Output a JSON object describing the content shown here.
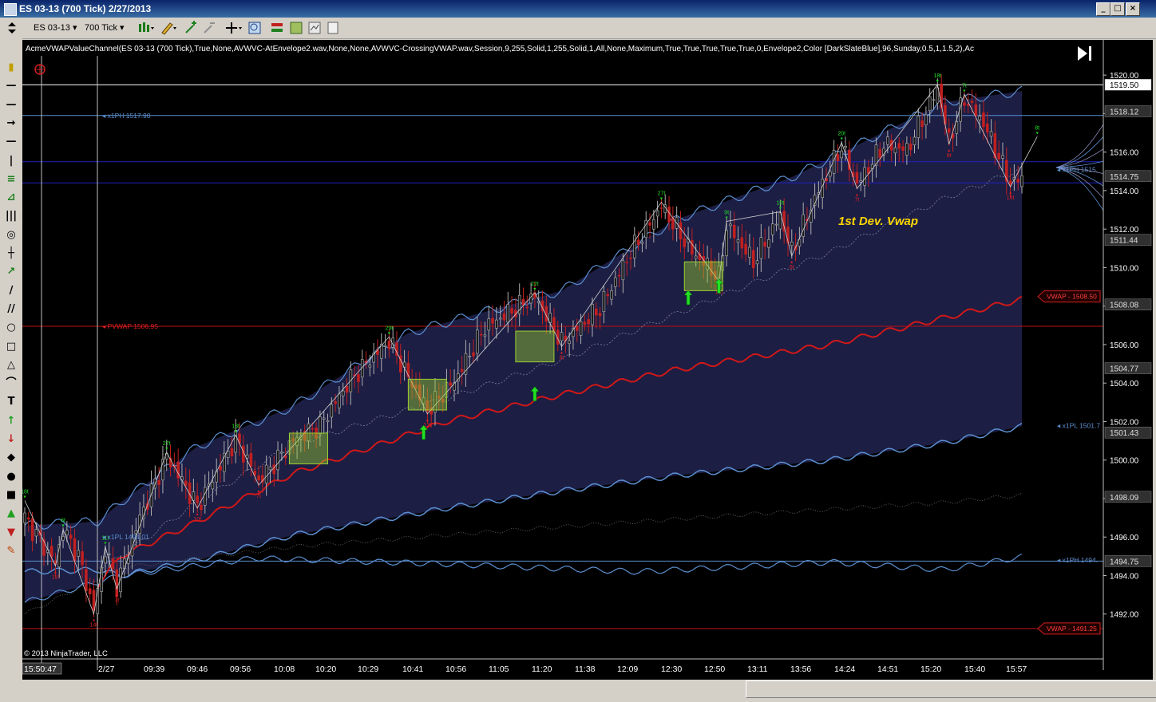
{
  "window": {
    "title": "ES 03-13 (700 Tick)  2/27/2013",
    "min_label": "_",
    "max_label": "□",
    "close_label": "×"
  },
  "toolbar": {
    "instrument": "ES 03-13",
    "interval": "700 Tick"
  },
  "lefttools": {
    "items": [
      "▮",
      "—",
      "—",
      "→",
      "—",
      "|",
      "≡",
      "⊿",
      "|||",
      "◎",
      "┼",
      "↗",
      "/",
      "//",
      "○",
      "□",
      "△",
      "⌒",
      "T",
      "↑",
      "↓",
      "◆",
      "●",
      "■",
      "▲",
      "▼",
      "✎"
    ]
  },
  "chart": {
    "indicator_label": "AcmeVWAPValueChannel(ES 03-13 (700 Tick),True,None,AVWVC-AtEnvelope2.wav,None,None,AVWVC-CrossingVWAP.wav,Session,9,255,Solid,1,255,Solid,1,All,None,Maximum,True,True,True,True,True,0,Envelope2,Color [DarkSlateBlue],96,Sunday,0.5,1,1.5,2),Ac",
    "annotation": "1st Dev. Vwap",
    "copyright": "© 2013 NinjaTrader, LLC",
    "colors": {
      "background": "#000000",
      "channel_fill": "#1e2048",
      "vwap": "#d01818",
      "band": "#5b8fd0",
      "inner_band": "#8080a0",
      "up_bar": "#b0b0b0",
      "down_bar": "#c02020",
      "swing_up": "#20e020",
      "swing_down": "#e02020",
      "annotation": "#ffd700",
      "box": "#9acd32",
      "arrow": "#22e022"
    }
  },
  "chart_data": {
    "type": "candlestick",
    "ylim": [
      1490,
      1521
    ],
    "y_ticks": [
      1492,
      1494,
      1496,
      1498,
      1500,
      1502,
      1504,
      1506,
      1508,
      1510,
      1512,
      1514,
      1516,
      1518,
      1520
    ],
    "y_tick_labels": [
      "1492.00",
      "1494.00",
      "1496.00",
      "1498.00",
      "1500.00",
      "1502.00",
      "1504.00",
      "1506.00",
      "1508.00",
      "1510.00",
      "1512.00",
      "1514.00",
      "1516.00",
      "1518.00",
      "1520.00"
    ],
    "x_tick_labels": [
      "15:50:47",
      "2/27",
      "09:39",
      "09:46",
      "09:56",
      "10:08",
      "10:20",
      "10:29",
      "10:41",
      "10:56",
      "11:05",
      "11:20",
      "11:38",
      "12:09",
      "12:30",
      "12:50",
      "13:11",
      "13:56",
      "14:24",
      "14:51",
      "15:20",
      "15:40",
      "15:57"
    ],
    "price_markers": [
      {
        "label": "1519.50",
        "value": 1519.5,
        "style": "white"
      },
      {
        "label": "1518.12",
        "value": 1518.12,
        "style": "gray"
      },
      {
        "label": "1514.75",
        "value": 1514.75,
        "style": "gray"
      },
      {
        "label": "1511.44",
        "value": 1511.44,
        "style": "gray"
      },
      {
        "label": "1508.08",
        "value": 1508.08,
        "style": "gray"
      },
      {
        "label": "1504.77",
        "value": 1504.77,
        "style": "gray"
      },
      {
        "label": "1501.43",
        "value": 1501.43,
        "style": "gray"
      },
      {
        "label": "1498.09",
        "value": 1498.09,
        "style": "gray"
      },
      {
        "label": "1494.75",
        "value": 1494.75,
        "style": "gray"
      }
    ],
    "level_labels": [
      {
        "label": "x1PH 1517.90",
        "value": 1517.9
      },
      {
        "label": "PVWAP 1506.95",
        "value": 1506.95
      },
      {
        "label": "x1PL 1494.01",
        "value": 1496.0
      },
      {
        "label": "x1PH 1515.",
        "value": 1515.1
      },
      {
        "label": "x1PL 1501.7",
        "value": 1501.8
      },
      {
        "label": "x1PH 1494.",
        "value": 1494.8
      }
    ],
    "vwap_tags": [
      {
        "label": "VWAP - 1508.50",
        "value": 1508.5
      },
      {
        "label": "VWAP - 1491.25",
        "value": 1491.25
      }
    ],
    "horizontal_lines": [
      {
        "value": 1519.5,
        "color": "#ffffff"
      },
      {
        "value": 1515.5,
        "color": "#2020c0"
      },
      {
        "value": 1514.4,
        "color": "#2020c0"
      },
      {
        "value": 1517.9,
        "color": "#5b8fd0"
      },
      {
        "value": 1506.95,
        "color": "#c01010"
      },
      {
        "value": 1494.75,
        "color": "#5b8fd0"
      },
      {
        "value": 1491.25,
        "color": "#c01010"
      }
    ],
    "swing_points": [
      {
        "label": "18t",
        "idx": 0,
        "price": 1497.9,
        "dir": "up"
      },
      {
        "label": "6t",
        "idx": 10,
        "price": 1496.4,
        "dir": "up"
      },
      {
        "label": "11t",
        "idx": 8,
        "price": 1494.5,
        "dir": "down"
      },
      {
        "label": "14t",
        "idx": 18,
        "price": 1492.0,
        "dir": "down"
      },
      {
        "label": "11t",
        "idx": 21,
        "price": 1495.5,
        "dir": "up"
      },
      {
        "label": "7t",
        "idx": 24,
        "price": 1493.3,
        "dir": "down"
      },
      {
        "label": "27t",
        "idx": 37,
        "price": 1500.4,
        "dir": "up"
      },
      {
        "label": "10t",
        "idx": 45,
        "price": 1497.5,
        "dir": "down"
      },
      {
        "label": "13t",
        "idx": 55,
        "price": 1501.3,
        "dir": "up"
      },
      {
        "label": "7t",
        "idx": 61,
        "price": 1498.7,
        "dir": "down"
      },
      {
        "label": "29t",
        "idx": 95,
        "price": 1506.4,
        "dir": "up"
      },
      {
        "label": "13t",
        "idx": 105,
        "price": 1502.4,
        "dir": "down"
      },
      {
        "label": "22t",
        "idx": 133,
        "price": 1508.7,
        "dir": "up"
      },
      {
        "label": "8t",
        "idx": 140,
        "price": 1505.9,
        "dir": "down"
      },
      {
        "label": "27t",
        "idx": 166,
        "price": 1513.4,
        "dir": "up"
      },
      {
        "label": "18t",
        "idx": 181,
        "price": 1509.3,
        "dir": "down"
      },
      {
        "label": "9t",
        "idx": 183,
        "price": 1512.4,
        "dir": "up"
      },
      {
        "label": "10t",
        "idx": 197,
        "price": 1512.9,
        "dir": "up"
      },
      {
        "label": "6t",
        "idx": 200,
        "price": 1510.6,
        "dir": "down"
      },
      {
        "label": "20t",
        "idx": 213,
        "price": 1516.5,
        "dir": "up"
      },
      {
        "label": "7t",
        "idx": 217,
        "price": 1514.1,
        "dir": "down"
      },
      {
        "label": "18t",
        "idx": 238,
        "price": 1519.5,
        "dir": "up"
      },
      {
        "label": "8t",
        "idx": 241,
        "price": 1516.4,
        "dir": "down"
      },
      {
        "label": "7t",
        "idx": 245,
        "price": 1519.0,
        "dir": "up"
      },
      {
        "label": "16t",
        "idx": 257,
        "price": 1514.2,
        "dir": "down"
      },
      {
        "label": "8t",
        "idx": 264,
        "price": 1516.8,
        "dir": "up"
      }
    ],
    "price_path": [
      [
        0,
        1497.0
      ],
      [
        8,
        1494.6
      ],
      [
        10,
        1496.4
      ],
      [
        14,
        1495.0
      ],
      [
        18,
        1492.2
      ],
      [
        21,
        1495.4
      ],
      [
        24,
        1493.5
      ],
      [
        30,
        1497.0
      ],
      [
        37,
        1500.2
      ],
      [
        45,
        1497.6
      ],
      [
        55,
        1501.1
      ],
      [
        61,
        1498.9
      ],
      [
        70,
        1501.0
      ],
      [
        77,
        1501.8
      ],
      [
        85,
        1504.2
      ],
      [
        95,
        1506.2
      ],
      [
        100,
        1504.3
      ],
      [
        105,
        1502.6
      ],
      [
        112,
        1504.1
      ],
      [
        120,
        1506.9
      ],
      [
        133,
        1508.5
      ],
      [
        140,
        1506.1
      ],
      [
        150,
        1507.9
      ],
      [
        158,
        1510.8
      ],
      [
        166,
        1513.2
      ],
      [
        174,
        1510.8
      ],
      [
        181,
        1509.5
      ],
      [
        183,
        1512.2
      ],
      [
        190,
        1510.3
      ],
      [
        197,
        1512.7
      ],
      [
        200,
        1510.8
      ],
      [
        206,
        1513.6
      ],
      [
        213,
        1516.3
      ],
      [
        217,
        1514.3
      ],
      [
        224,
        1516.4
      ],
      [
        230,
        1516.1
      ],
      [
        238,
        1519.3
      ],
      [
        241,
        1516.6
      ],
      [
        245,
        1518.8
      ],
      [
        250,
        1517.5
      ],
      [
        257,
        1514.4
      ],
      [
        260,
        1514.6
      ]
    ],
    "bar_count": 261,
    "bands": {
      "vwap": [
        [
          0,
          null
        ],
        [
          19,
          1493.5
        ],
        [
          25,
          1495.0
        ],
        [
          45,
          1496.8
        ],
        [
          70,
          1499.3
        ],
        [
          110,
          1502.0
        ],
        [
          140,
          1503.4
        ],
        [
          170,
          1504.7
        ],
        [
          210,
          1506.0
        ],
        [
          240,
          1507.4
        ],
        [
          261,
          1508.4
        ]
      ],
      "upper1": [
        [
          0,
          1496.6
        ],
        [
          19,
          1496.8
        ],
        [
          25,
          1497.8
        ],
        [
          45,
          1500.7
        ],
        [
          70,
          1502.8
        ],
        [
          100,
          1506.6
        ],
        [
          140,
          1508.8
        ],
        [
          170,
          1512.5
        ],
        [
          200,
          1514.7
        ],
        [
          240,
          1518.6
        ],
        [
          261,
          1519.2
        ]
      ],
      "lower_channel": [
        [
          0,
          1494.2
        ],
        [
          19,
          1494.3
        ],
        [
          25,
          1494.0
        ],
        [
          45,
          1494.8
        ],
        [
          70,
          1496.1
        ],
        [
          110,
          1497.5
        ],
        [
          140,
          1498.4
        ],
        [
          170,
          1499.2
        ],
        [
          210,
          1500.0
        ],
        [
          240,
          1500.9
        ],
        [
          261,
          1501.8
        ]
      ],
      "upper_channel": [
        [
          0,
          1494.2
        ],
        [
          19,
          1494.3
        ],
        [
          25,
          1495.0
        ],
        [
          45,
          1497.8
        ],
        [
          70,
          1500.8
        ],
        [
          110,
          1503.2
        ],
        [
          140,
          1505.2
        ],
        [
          170,
          1507.6
        ],
        [
          210,
          1510.8
        ],
        [
          240,
          1513.6
        ],
        [
          261,
          1515.2
        ]
      ],
      "lower2": [
        [
          0,
          1492.6
        ],
        [
          25,
          1494.0
        ],
        [
          60,
          1494.9
        ],
        [
          110,
          1494.6
        ],
        [
          160,
          1494.2
        ],
        [
          210,
          1494.7
        ],
        [
          240,
          1494.3
        ],
        [
          261,
          1495.0
        ]
      ],
      "lower3": [
        [
          0,
          1492.0
        ],
        [
          25,
          1494.4
        ],
        [
          70,
          1495.5
        ],
        [
          130,
          1496.4
        ],
        [
          190,
          1497.2
        ],
        [
          240,
          1497.8
        ],
        [
          261,
          1498.2
        ]
      ]
    },
    "boxes": [
      {
        "idx0": 69,
        "idx1": 79,
        "top": 1501.4,
        "bottom": 1499.8
      },
      {
        "idx0": 100,
        "idx1": 110,
        "top": 1504.2,
        "bottom": 1502.6
      },
      {
        "idx0": 128,
        "idx1": 138,
        "top": 1506.7,
        "bottom": 1505.1
      },
      {
        "idx0": 172,
        "idx1": 182,
        "top": 1510.3,
        "bottom": 1508.8
      }
    ],
    "up_arrows": [
      {
        "idx": 104,
        "price": 1501.4
      },
      {
        "idx": 133,
        "price": 1503.4
      },
      {
        "idx": 173,
        "price": 1508.4
      },
      {
        "idx": 181,
        "price": 1509.0
      }
    ]
  }
}
